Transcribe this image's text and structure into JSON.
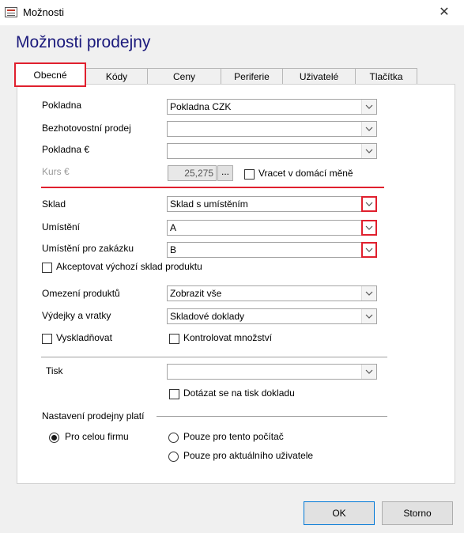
{
  "window": {
    "title": "Možnosti",
    "close_glyph": "✕"
  },
  "heading": "Možnosti prodejny",
  "tabs": [
    {
      "label": "Obecné",
      "active": true
    },
    {
      "label": "Kódy"
    },
    {
      "label": "Ceny"
    },
    {
      "label": "Periferie"
    },
    {
      "label": "Uživatelé"
    },
    {
      "label": "Tlačítka"
    }
  ],
  "payment": {
    "pokladna_label": "Pokladna",
    "pokladna_value": "Pokladna CZK",
    "bezhot_label": "Bezhotovostní prodej",
    "bezhot_value": "",
    "pokladna_eur_label": "Pokladna €",
    "pokladna_eur_value": "",
    "kurs_label": "Kurs €",
    "kurs_value": "25,275",
    "kurs_btn": "...",
    "vracet_label": "Vracet v domácí měně",
    "vracet_checked": false
  },
  "stock": {
    "sklad_label": "Sklad",
    "sklad_value": "Sklad s umístěním",
    "umisteni_label": "Umístění",
    "umisteni_value": "A",
    "umisteni_zakazka_label": "Umístění pro zakázku",
    "umisteni_zakazka_value": "B",
    "akceptovat_label": "Akceptovat výchozí sklad produktu",
    "akceptovat_checked": false
  },
  "products": {
    "omezeni_label": "Omezení produktů",
    "omezeni_value": "Zobrazit vše",
    "vydejky_label": "Výdejky a vratky",
    "vydejky_value": "Skladové doklady",
    "vyskladnovat_label": "Vyskladňovat",
    "vyskladnovat_checked": false,
    "kontrolovat_label": "Kontrolovat množství",
    "kontrolovat_checked": false
  },
  "print": {
    "tisk_label": "Tisk",
    "tisk_value": "",
    "dotazat_label": "Dotázat se na tisk dokladu",
    "dotazat_checked": false
  },
  "scope": {
    "heading": "Nastavení prodejny platí",
    "options": [
      {
        "label": "Pro celou firmu",
        "selected": true
      },
      {
        "label": "Pouze pro tento počítač",
        "selected": false
      },
      {
        "label": "Pouze pro aktuálního uživatele",
        "selected": false
      }
    ]
  },
  "buttons": {
    "ok": "OK",
    "cancel": "Storno"
  },
  "colors": {
    "heading": "#1b1a7c",
    "highlight": "#e0202e",
    "focus": "#0078d7"
  },
  "icons": {
    "dropdown": "chevron-down-icon",
    "app": "form-icon",
    "close": "close-icon"
  }
}
